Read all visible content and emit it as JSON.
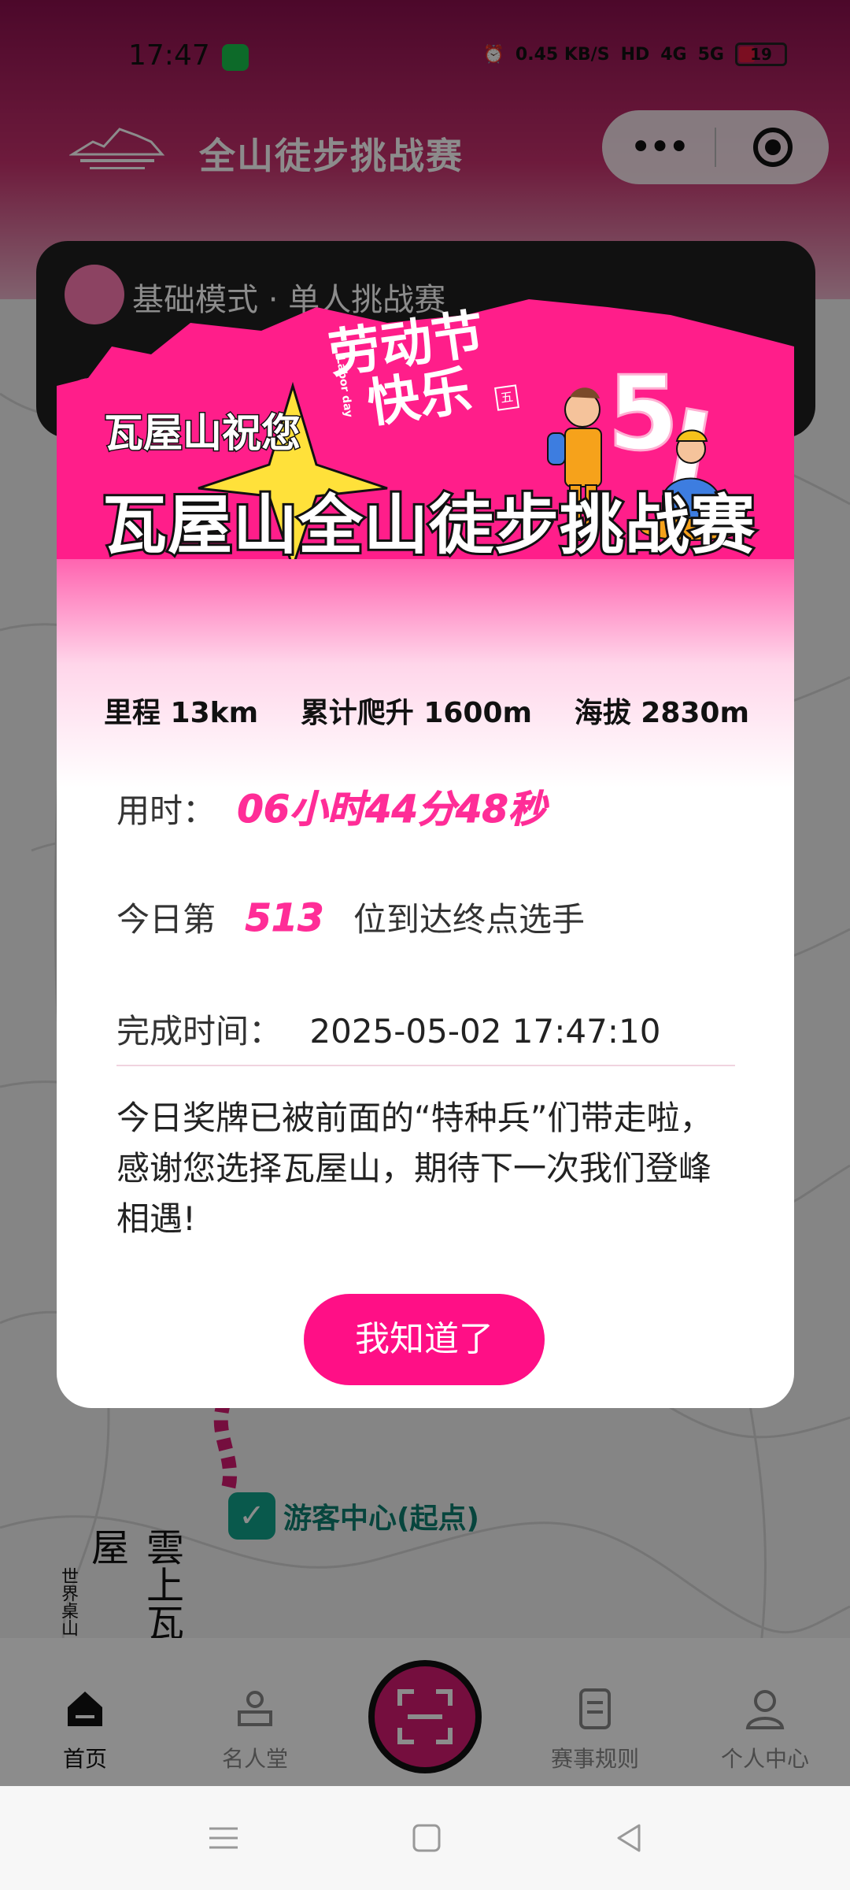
{
  "status_bar": {
    "time": "17:47",
    "network_speed": "0.45 KB/S",
    "hd_label": "HD",
    "signal_4g": "4G",
    "signal_5g": "5G",
    "battery": "19"
  },
  "header": {
    "app_title": "全山徒步挑战赛",
    "capsule_more": "•••"
  },
  "mode_card": {
    "label": "基础模式 · 单人挑战赛"
  },
  "map": {
    "spot_label": "游客中心(起点)",
    "brand_big": "雲上瓦屋",
    "brand_small": "世界桌山"
  },
  "modal": {
    "holiday_line1": "劳动节",
    "holiday_line2": "快乐",
    "holiday_en": "Labor day",
    "stamp": "五",
    "five_one": "5",
    "greeting": "瓦屋山祝您",
    "event_title": "瓦屋山全山徒步挑战赛",
    "stats": {
      "distance": "里程 13km",
      "elevation_gain": "累计爬升 1600m",
      "altitude": "海拔 2830m"
    },
    "duration_label": "用时：",
    "duration_value": "06小时44分48秒",
    "rank_prefix": "今日第",
    "rank_value": "513",
    "rank_suffix": "位到达终点选手",
    "finish_label": "完成时间：",
    "finish_value": "2025-05-02 17:47:10",
    "message": "今日奖牌已被前面的“特种兵”们带走啦，感谢您选择瓦屋山，期待下一次我们登峰相遇!",
    "ok_button": "我知道了"
  },
  "tab_bar": {
    "home": "首页",
    "hall_of_fame": "名人堂",
    "rules": "赛事规则",
    "profile": "个人中心"
  },
  "colors": {
    "brand_pink": "#ff0f86",
    "highlight": "#ff2d97",
    "header_maroon": "#8b0f4e"
  }
}
